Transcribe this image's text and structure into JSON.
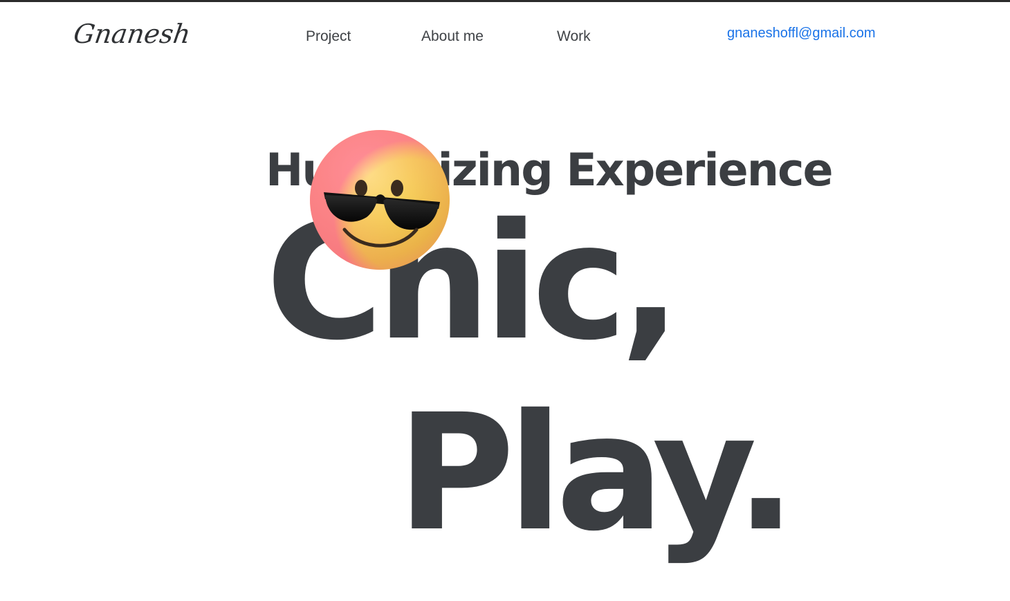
{
  "brand": {
    "logo_text": "Gnanesh"
  },
  "nav": {
    "items": [
      {
        "label": "Project"
      },
      {
        "label": "About me"
      },
      {
        "label": "Work"
      }
    ],
    "email": "gnaneshoffl@gmail.com"
  },
  "hero": {
    "subtitle": "Humanizing Experience",
    "line1": "Chic,",
    "line2": "Play.",
    "emoji": "sunglasses-smiley-icon"
  },
  "colors": {
    "text": "#3b3e42",
    "link": "#1a73e8",
    "emoji_face": "#f4c84a",
    "emoji_glow": "#ff6b9a"
  }
}
